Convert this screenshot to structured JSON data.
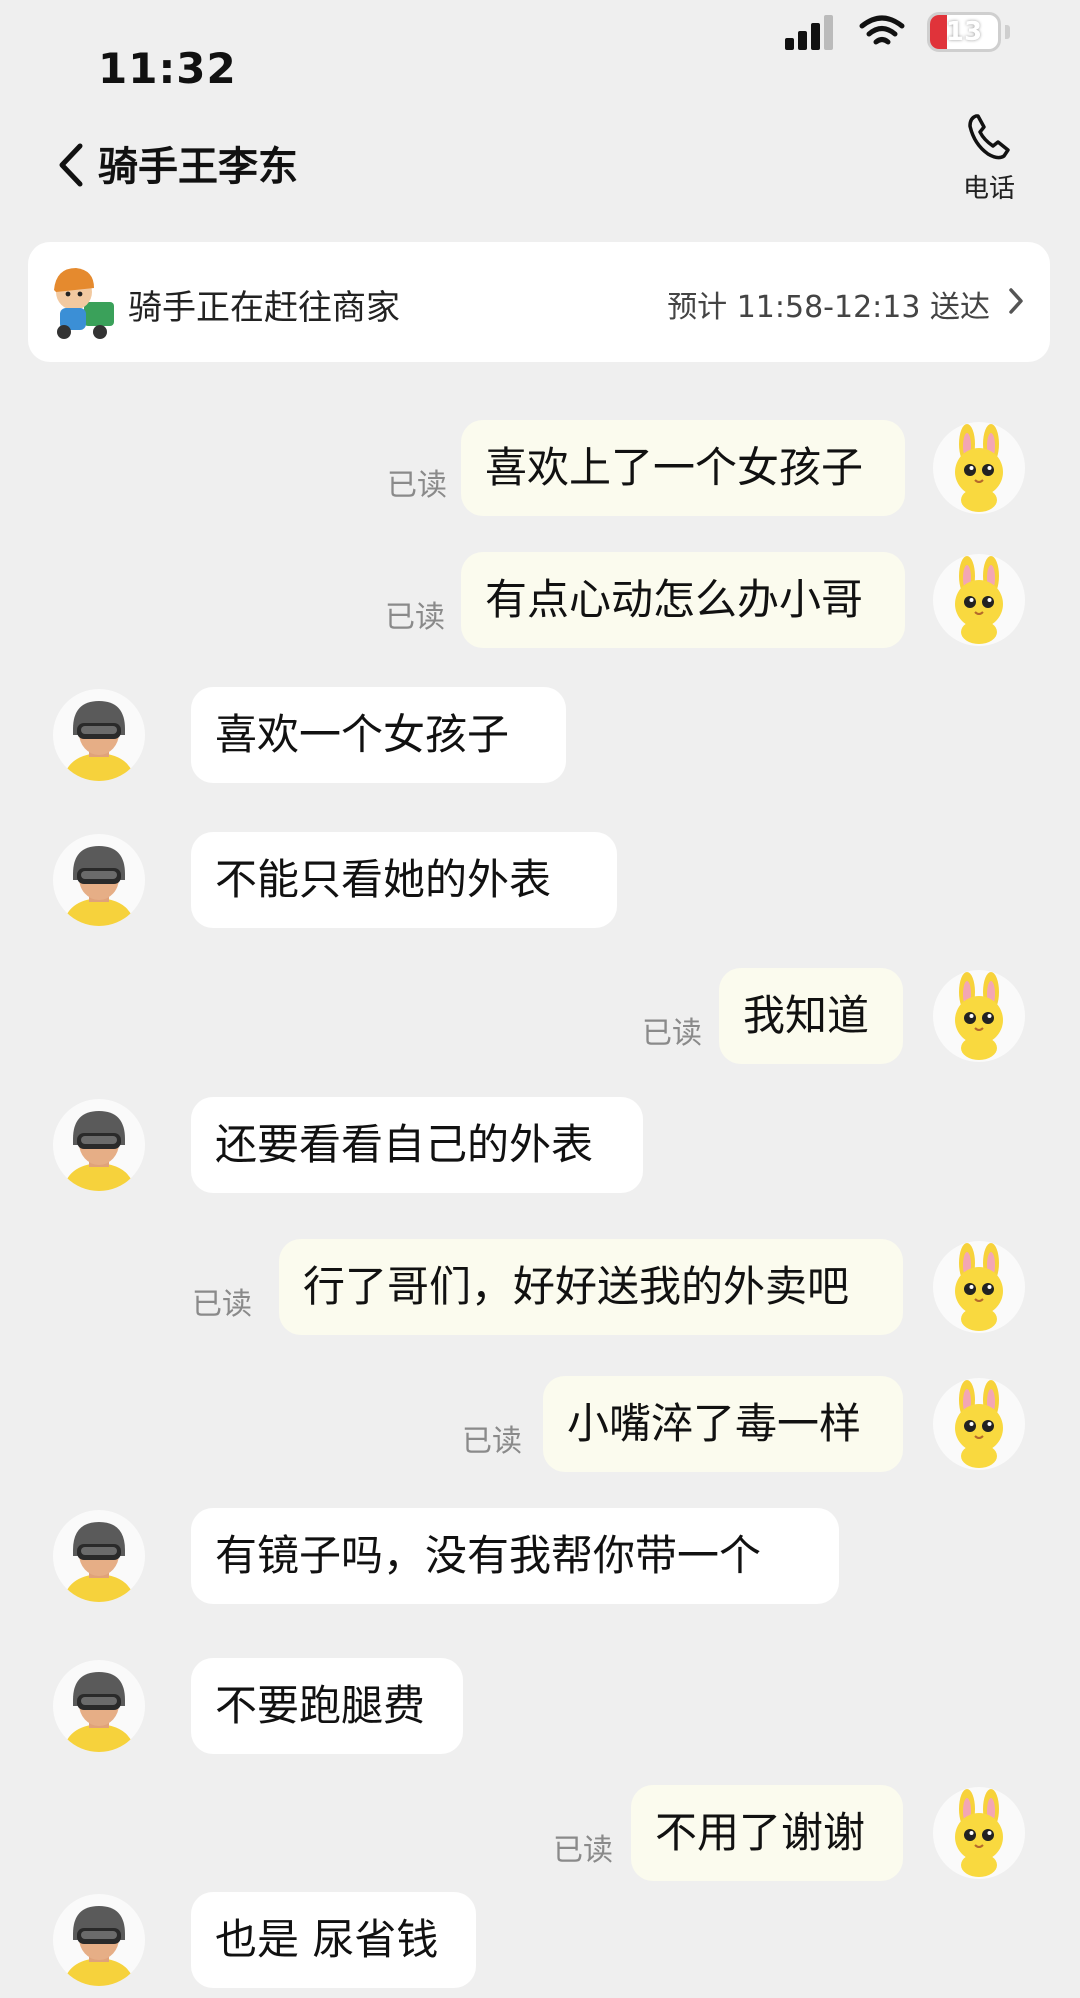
{
  "status_bar": {
    "time": "11:32",
    "battery": "13",
    "battery_fraction": 0.13
  },
  "header": {
    "title": "骑手王李东",
    "phone_label": "电话"
  },
  "delivery": {
    "status": "骑手正在赶往商家",
    "eta": "预计 11:58-12:13 送达"
  },
  "read_label": "已读",
  "messages": [
    {
      "from": "me",
      "text": "喜欢上了一个女孩子"
    },
    {
      "from": "me",
      "text": "有点心动怎么办小哥"
    },
    {
      "from": "rider",
      "text": "喜欢一个女孩子"
    },
    {
      "from": "rider",
      "text": "不能只看她的外表"
    },
    {
      "from": "me",
      "text": "我知道"
    },
    {
      "from": "rider",
      "text": "还要看看自己的外表"
    },
    {
      "from": "me",
      "text": "行了哥们，好好送我的外卖吧"
    },
    {
      "from": "me",
      "text": "小嘴淬了毒一样"
    },
    {
      "from": "rider",
      "text": "有镜子吗，没有我帮你带一个"
    },
    {
      "from": "rider",
      "text": "不要跑腿费"
    },
    {
      "from": "me",
      "text": "不用了谢谢"
    },
    {
      "from": "rider",
      "text": "也是 尿省钱"
    }
  ]
}
